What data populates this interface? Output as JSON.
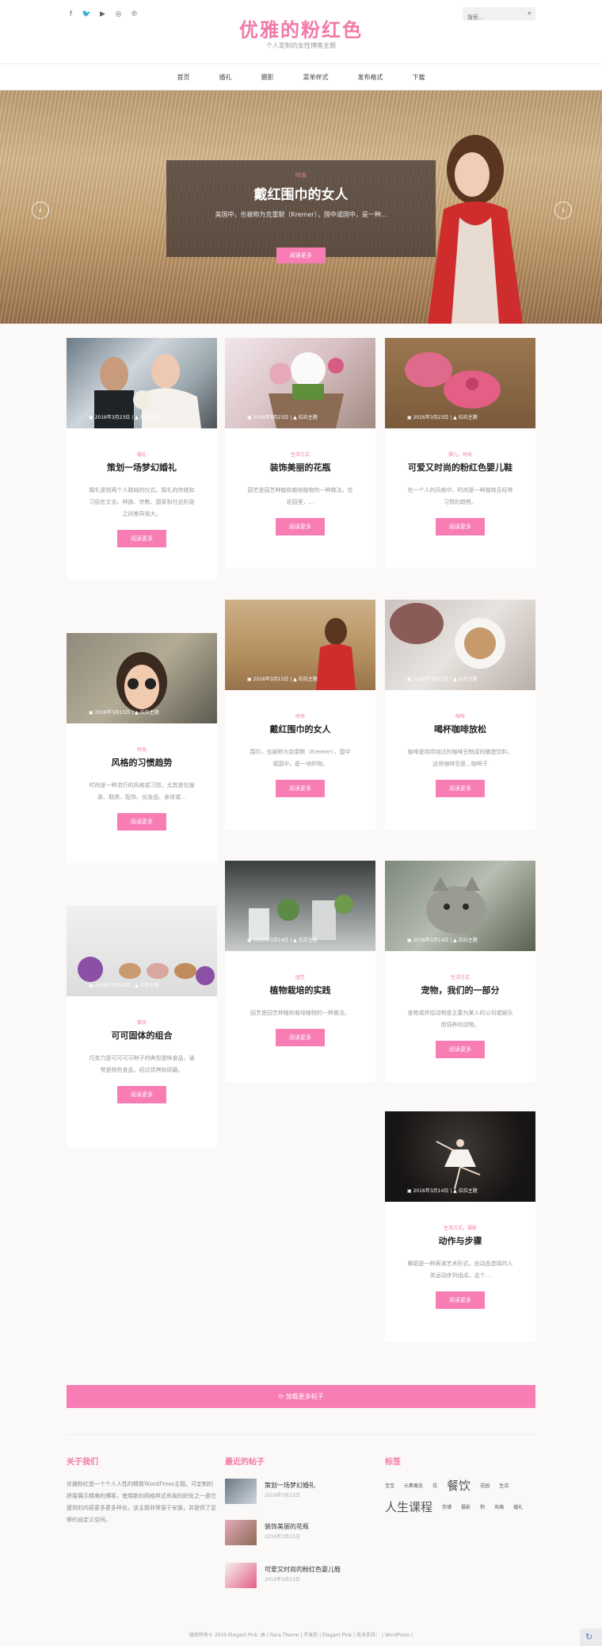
{
  "header": {
    "social": [
      {
        "icon": "facebook-icon",
        "glyph": "f"
      },
      {
        "icon": "twitter-icon",
        "glyph": "🐦"
      },
      {
        "icon": "youtube-icon",
        "glyph": "▶"
      },
      {
        "icon": "instagram-icon",
        "glyph": "◎"
      },
      {
        "icon": "pinterest-icon",
        "glyph": "℗"
      }
    ],
    "title": "优雅的粉红色",
    "subtitle": "个人定制的女性博客主题",
    "search_placeholder": "搜索...",
    "search_icon": "⌕"
  },
  "nav": [
    "首页",
    "婚礼",
    "摄影",
    "菜单样式",
    "发布格式",
    "下载"
  ],
  "hero": {
    "category": "时尚",
    "title": "戴红围巾的女人",
    "excerpt": "美国中，也被称为克雷默（Kremer），国中或国中，是一种...",
    "button": "阅读更多",
    "prev": "‹",
    "next": "›"
  },
  "cards": [
    {
      "date": "2016年3月23日",
      "author": "拉拉主题",
      "category": "婚礼",
      "title": "策划一场梦幻婚礼",
      "excerpt": "婚礼是指两个人联结的仪式。婚礼的传统和习俗在文化、种族、宗教、国家和社会阶层之间差异很大。",
      "button": "阅读更多"
    },
    {
      "date": "2016年3月23日",
      "author": "拉拉主题",
      "category": "生活方式",
      "title": "装饰美丽的花瓶",
      "excerpt": "园艺是园艺种植和栽培植物的一种做法。在花园里，...",
      "button": "阅读更多"
    },
    {
      "date": "2016年3月23日",
      "author": "拉拉主题",
      "category": "婴儿，时尚",
      "title": "可爱又时尚的粉红色婴儿鞋",
      "excerpt": "在一个人的风格中，时尚是一种独特且经常习惯的趋势。",
      "button": "阅读更多"
    },
    {
      "date": "2016年3月15日",
      "author": "拉拉主题",
      "category": "时尚",
      "title": "戴红围巾的女人",
      "excerpt": "围巾，也被称为克雷默（Kremer），国中或国中，是一块织物。",
      "button": "阅读更多"
    },
    {
      "date": "2016年3月15日",
      "author": "拉拉主题",
      "category": "咖啡",
      "title": "喝杯咖啡放松",
      "excerpt": "咖啡是用烘焙过的咖啡豆制成的酿造饮料，这些咖啡豆是...咖啡子",
      "button": "阅读更多"
    },
    {
      "date": "2016年3月15日",
      "author": "拉拉主题",
      "category": "时尚",
      "title": "风格的习惯趋势",
      "excerpt": "时尚是一种流行的风格或习惯，尤其是在服装、鞋类、配饰、化妆品、身体或...",
      "button": "阅读更多"
    },
    {
      "date": "2016年3月14日",
      "author": "拉拉主题",
      "category": "园艺",
      "title": "植物栽培的实践",
      "excerpt": "园艺是园艺种植和栽培植物的一种做法。",
      "button": "阅读更多"
    },
    {
      "date": "2016年3月14日",
      "author": "拉拉主题",
      "category": "生活方式",
      "title": "宠物，我们的一部分",
      "excerpt": "宠物或伴侣动物是主要为某人的公司或娱乐而饲养的动物。",
      "button": "阅读更多"
    },
    {
      "date": "2016年3月14日",
      "author": "拉拉主题",
      "category": "餐饮",
      "title": "可可固体的组合",
      "excerpt": "巧克力是可可可可种子的典型甜味食品，通常是棕色食品，经过烘烤和研磨。",
      "button": "阅读更多"
    },
    {
      "date": "2016年3月14日",
      "author": "拉拉主题",
      "category": "生活方式，摄影",
      "title": "动作与步骤",
      "excerpt": "舞蹈是一种表演艺术形式，由动态选择的人类运动序列组成，这个...",
      "button": "阅读更多"
    }
  ],
  "load_more": "⟳ 加载更多帖子",
  "footer": {
    "about_title": "关于我们",
    "about_text": "优雅粉红是一个个人人性的精致WordPress主题。可定制的拼接展示精美的博客，使用新的网格样式布局的好处之一是它提供的内容更多更多样化，该主题非常易于安装，并提供了足够的自定义空间。",
    "recent_title": "最近的帖子",
    "recent": [
      {
        "title": "策划一场梦幻婚礼",
        "date": "2016年3月23日"
      },
      {
        "title": "装饰美丽的花瓶",
        "date": "2016年3月23日"
      },
      {
        "title": "可爱又时尚的粉红色婴儿鞋",
        "date": "2016年3月23日"
      }
    ],
    "tags_title": "标签",
    "tags": [
      {
        "label": "宝宝",
        "size": 6
      },
      {
        "label": "元素概念",
        "size": 6
      },
      {
        "label": "花",
        "size": 6
      },
      {
        "label": "餐饮",
        "size": 15
      },
      {
        "label": "花园",
        "size": 6
      },
      {
        "label": "生活",
        "size": 6
      },
      {
        "label": "人生课程",
        "size": 15
      },
      {
        "label": "存储",
        "size": 6
      },
      {
        "label": "摄影",
        "size": 6
      },
      {
        "label": "狗",
        "size": 6
      },
      {
        "label": "风格",
        "size": 6
      },
      {
        "label": "婚礼",
        "size": 6
      }
    ],
    "copyright": "版权所有© 2020 Elegant Pink.   由   |   Rara Theme   |   开发的   |   Elegant Pink   |   技术支持：   |   WordPress   |"
  },
  "colors": {
    "accent": "#f27aa8",
    "button": "#f77db4"
  }
}
